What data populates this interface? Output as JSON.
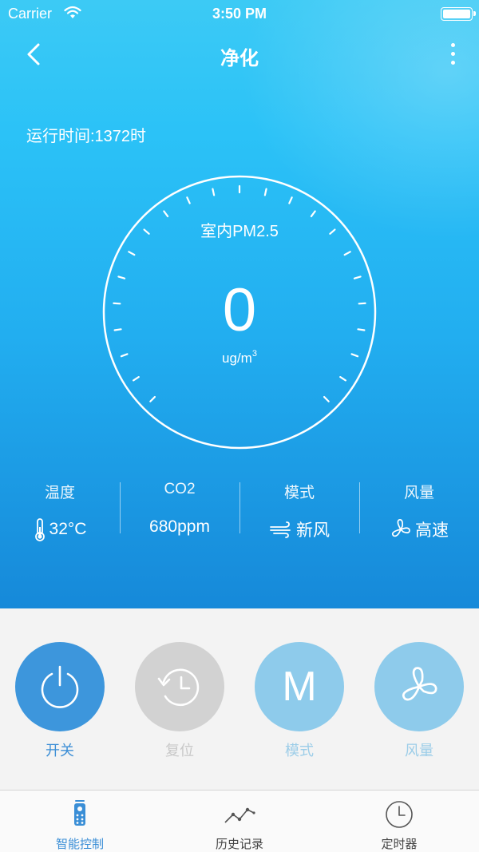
{
  "status_bar": {
    "carrier": "Carrier",
    "time": "3:50 PM"
  },
  "nav": {
    "title": "净化"
  },
  "runtime_text": "运行时间:1372时",
  "dial": {
    "label": "室内PM2.5",
    "value": "0",
    "unit": "ug/m",
    "unit_sup": "3"
  },
  "stats": [
    {
      "label": "温度",
      "value": "32°C",
      "icon": "thermometer-icon"
    },
    {
      "label": "CO2",
      "value": "680ppm",
      "icon": ""
    },
    {
      "label": "模式",
      "value": "新风",
      "icon": "wind-icon"
    },
    {
      "label": "风量",
      "value": "高速",
      "icon": "fan-icon"
    }
  ],
  "controls": [
    {
      "label": "开关",
      "icon": "power-icon",
      "color": "#3d96dc",
      "label_color": "#3d8fd6"
    },
    {
      "label": "复位",
      "icon": "history-icon",
      "color": "#d2d2d2",
      "label_color": "#c8c8c8"
    },
    {
      "label": "模式",
      "icon": "mode-m-icon",
      "glyph": "M",
      "color": "#8ecbeb",
      "label_color": "#9ccde8"
    },
    {
      "label": "风量",
      "icon": "fan-icon",
      "color": "#8ecbeb",
      "label_color": "#9ccde8"
    }
  ],
  "tabs": [
    {
      "label": "智能控制",
      "icon": "remote-control-icon",
      "active": true
    },
    {
      "label": "历史记录",
      "icon": "line-chart-icon",
      "active": false
    },
    {
      "label": "定时器",
      "icon": "clock-icon",
      "active": false
    }
  ],
  "colors": {
    "accent": "#3d96dc",
    "tab_active": "#3a8ed6",
    "tab_inactive": "#444444"
  }
}
